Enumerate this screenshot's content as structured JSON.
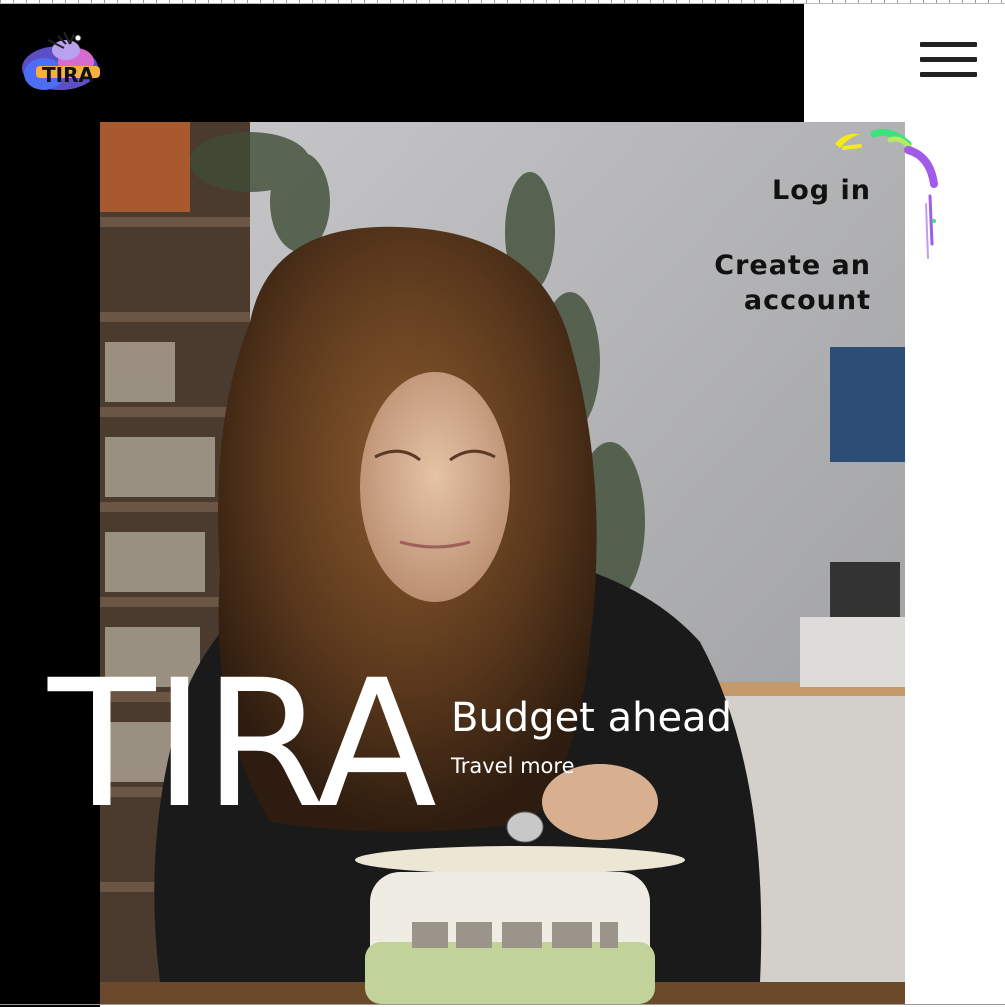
{
  "header": {
    "logo_text": "TIRA",
    "menu_icon": "hamburger-menu-icon"
  },
  "nav": {
    "login_label": "Log in",
    "create_account_label": "Create an account"
  },
  "hero": {
    "brand": "TIRA",
    "tagline": "Budget ahead",
    "subline": "Travel more",
    "image_alt": "Girl putting a coin into a van-shaped piggy bank"
  },
  "colors": {
    "header_bg": "#000000",
    "page_bg": "#ffffff",
    "nav_text": "#111111",
    "hero_text": "#ffffff",
    "splash_yellow": "#f2ea1c",
    "splash_green": "#3be37a",
    "splash_purple": "#a05be8"
  }
}
